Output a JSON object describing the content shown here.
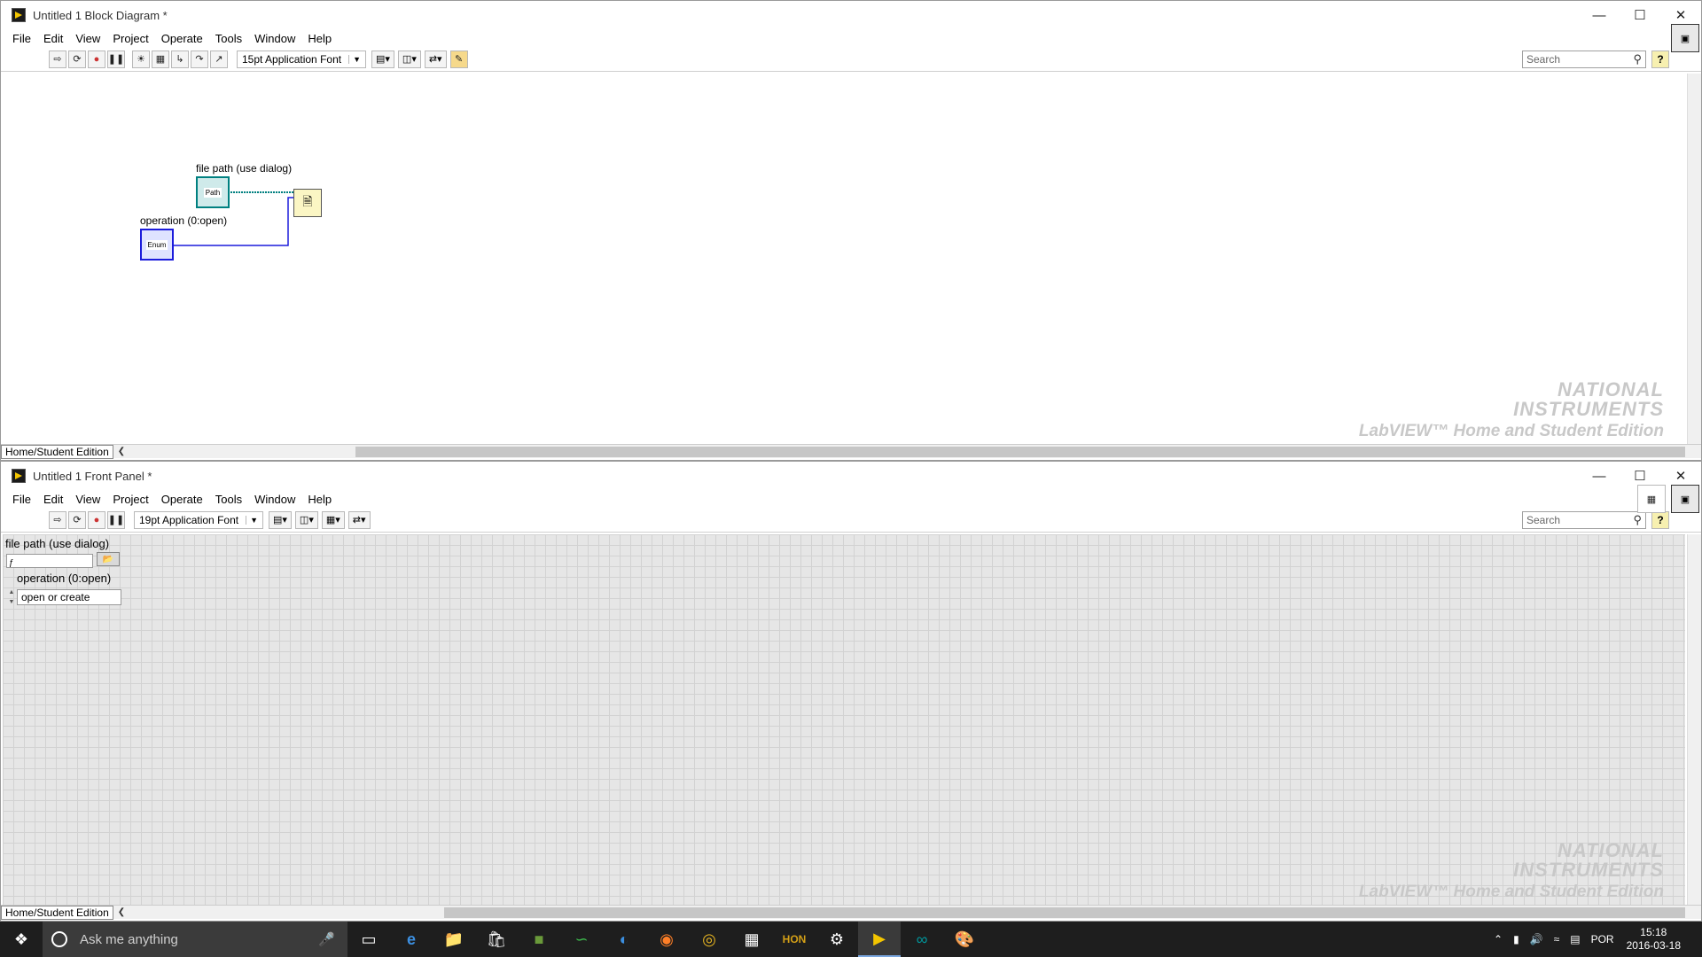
{
  "block_diagram": {
    "title": "Untitled 1 Block Diagram *",
    "menu": [
      "File",
      "Edit",
      "View",
      "Project",
      "Operate",
      "Tools",
      "Window",
      "Help"
    ],
    "font_select": "15pt Application Font",
    "search_placeholder": "Search",
    "help_label": "?",
    "status_label": "Home/Student Edition",
    "label_file_path": "file path (use dialog)",
    "label_operation": "operation (0:open)",
    "path_terminal_text": "Path",
    "enum_terminal_text": "Enum",
    "watermark_line1": "NATIONAL",
    "watermark_line2": "INSTRUMENTS",
    "watermark_line3": "LabVIEW™ Home and Student Edition"
  },
  "front_panel": {
    "title": "Untitled 1 Front Panel *",
    "menu": [
      "File",
      "Edit",
      "View",
      "Project",
      "Operate",
      "Tools",
      "Window",
      "Help"
    ],
    "font_select": "19pt Application Font",
    "search_placeholder": "Search",
    "help_label": "?",
    "status_label": "Home/Student Edition",
    "label_file_path": "file path (use dialog)",
    "label_operation": "operation (0:open)",
    "operation_value": "open or create",
    "path_glyph": "ƒ",
    "watermark_line1": "NATIONAL",
    "watermark_line2": "INSTRUMENTS",
    "watermark_line3": "LabVIEW™ Home and Student Edition"
  },
  "taskbar": {
    "search_placeholder": "Ask me anything",
    "language": "POR",
    "time": "15:18",
    "date": "2016-03-18"
  },
  "colors": {
    "path_wire": "#008080",
    "enum_wire": "#1c1cdc",
    "grid_bg": "#e6e6e6"
  }
}
